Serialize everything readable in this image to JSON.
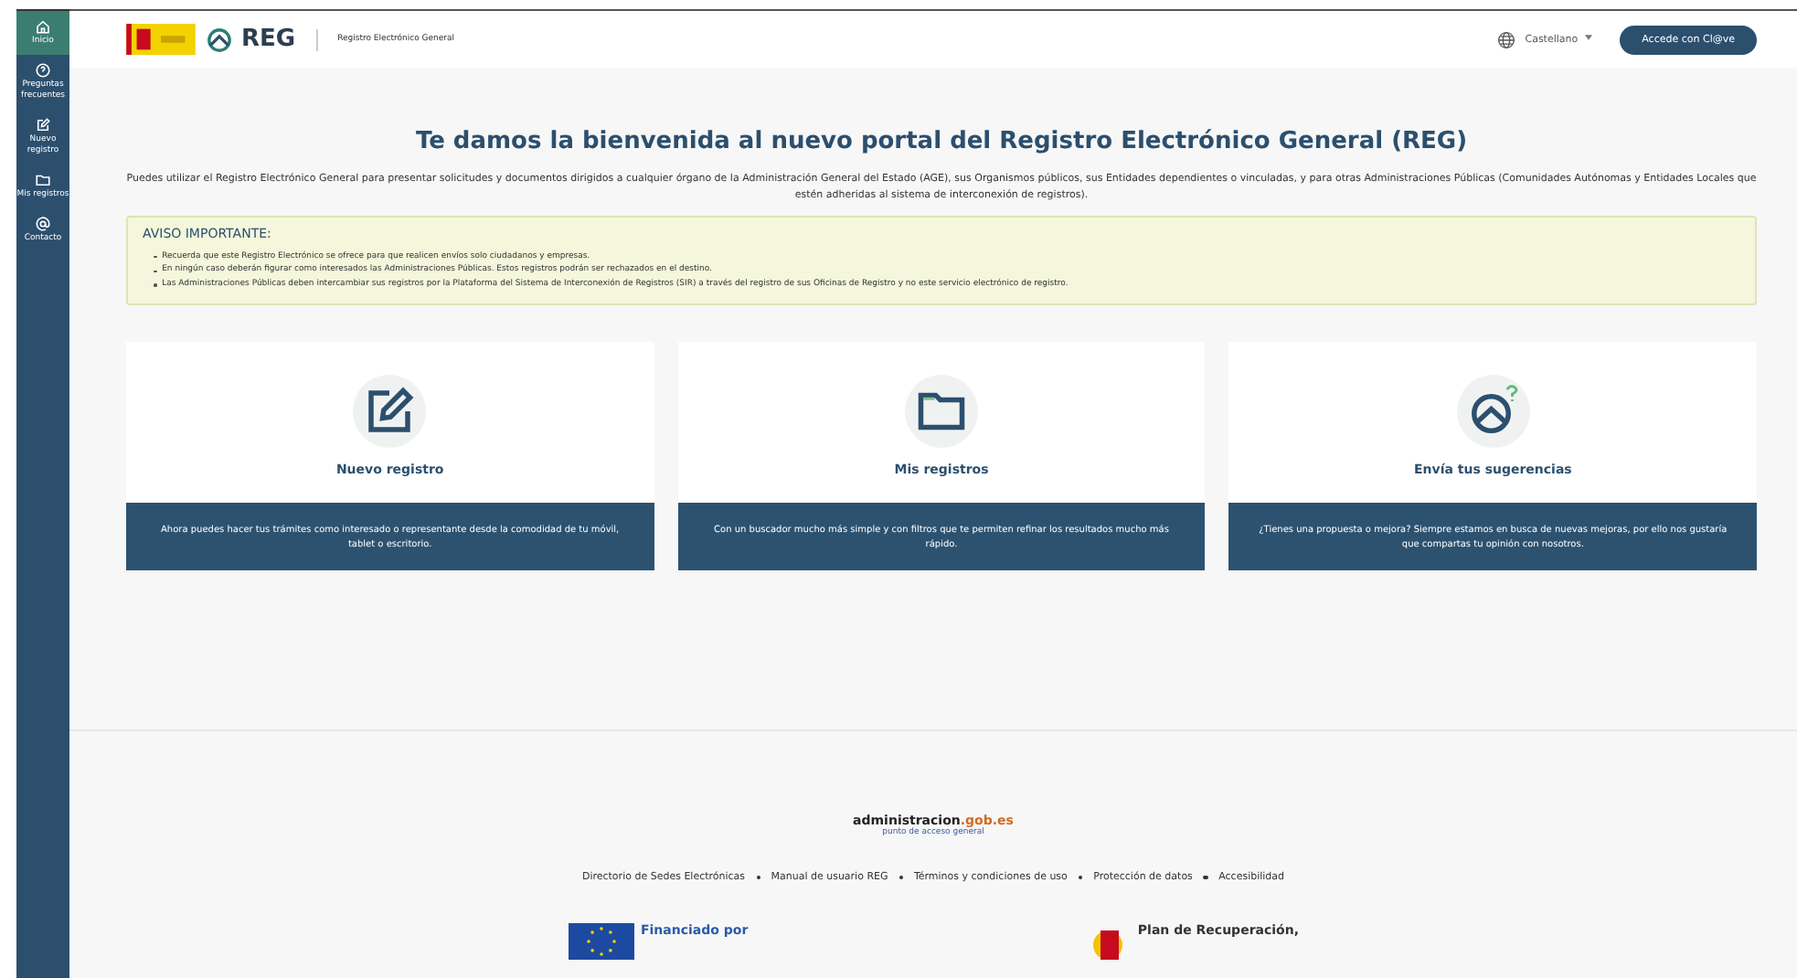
{
  "sidebar": {
    "items": [
      {
        "label": "Inicio",
        "selected": true
      },
      {
        "label": "Preguntas frecuentes",
        "selected": false
      },
      {
        "label": "Nuevo registro",
        "selected": false
      },
      {
        "label": "Mis registros",
        "selected": false
      },
      {
        "label": "Contacto",
        "selected": false
      }
    ]
  },
  "header": {
    "logo_text": "REG",
    "subtitle": "Registro Electrónico General",
    "language": "Castellano",
    "login_button": "Accede con Cl@ve"
  },
  "title": "Te damos la bienvenida al nuevo portal del Registro Electrónico General (REG)",
  "intro": "Puedes utilizar el Registro Electrónico General para presentar solicitudes y documentos dirigidos a cualquier órgano de la Administración General del Estado (AGE), sus Organismos públicos, sus Entidades dependientes o vinculadas, y para otras Administraciones Públicas (Comunidades Autónomas y Entidades Locales que estén adheridas al sistema de interconexión de registros).",
  "notice": {
    "title": "AVISO IMPORTANTE:",
    "items": [
      "Recuerda que este Registro Electrónico se ofrece para que realicen envíos solo ciudadanos y empresas.",
      "En ningún caso deberán figurar como interesados las Administraciones Públicas. Estos registros podrán ser rechazados en el destino.",
      "Las Administraciones Públicas deben intercambiar sus registros por la Plataforma del Sistema de Interconexión de Registros (SIR) a través del registro de sus Oficinas de Registro y no este servicio electrónico de registro."
    ]
  },
  "cards": [
    {
      "title": "Nuevo registro",
      "description": "Ahora puedes hacer tus trámites como interesado o representante desde la comodidad de tu móvil, tablet o escritorio."
    },
    {
      "title": "Mis registros",
      "description": "Con un buscador mucho más simple y con filtros que te permiten refinar los resultados mucho más rápido."
    },
    {
      "title": "Envía tus sugerencias",
      "description": "¿Tienes una propuesta o mejora? Siempre estamos en busca de nuevas mejoras, por ello nos gustaría que compartas tu opinión con nosotros."
    }
  ],
  "footer": {
    "portal_name": "administracion",
    "portal_domain": ".gob.es",
    "portal_tagline": "punto de acceso general",
    "links": [
      "Directorio de Sedes Electrónicas",
      "Manual de usuario REG",
      "Términos y condiciones de uso",
      "Protección de datos",
      "Accesibilidad"
    ],
    "eu_text": "Financiado por",
    "plan_text": "Plan de Recuperación,"
  }
}
